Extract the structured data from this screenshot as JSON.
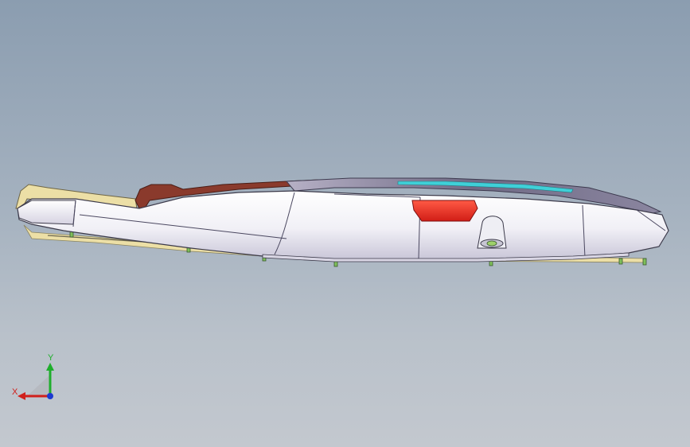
{
  "viewport": {
    "background_top": "#8b9db0",
    "background_bottom": "#c3c8cf"
  },
  "model": {
    "body_color": "#f4f4f8",
    "shadow_color": "#c7c5d6",
    "lens_color": "#e83a30",
    "trim_color": "#8a3a2c",
    "accent_color": "#3fd0d8",
    "base_color": "#ecdfa6"
  },
  "triad": {
    "x_label": "X",
    "y_label": "Y",
    "x_color": "#d0201c",
    "y_color": "#1fae2c",
    "z_color": "#1c3ad0"
  }
}
